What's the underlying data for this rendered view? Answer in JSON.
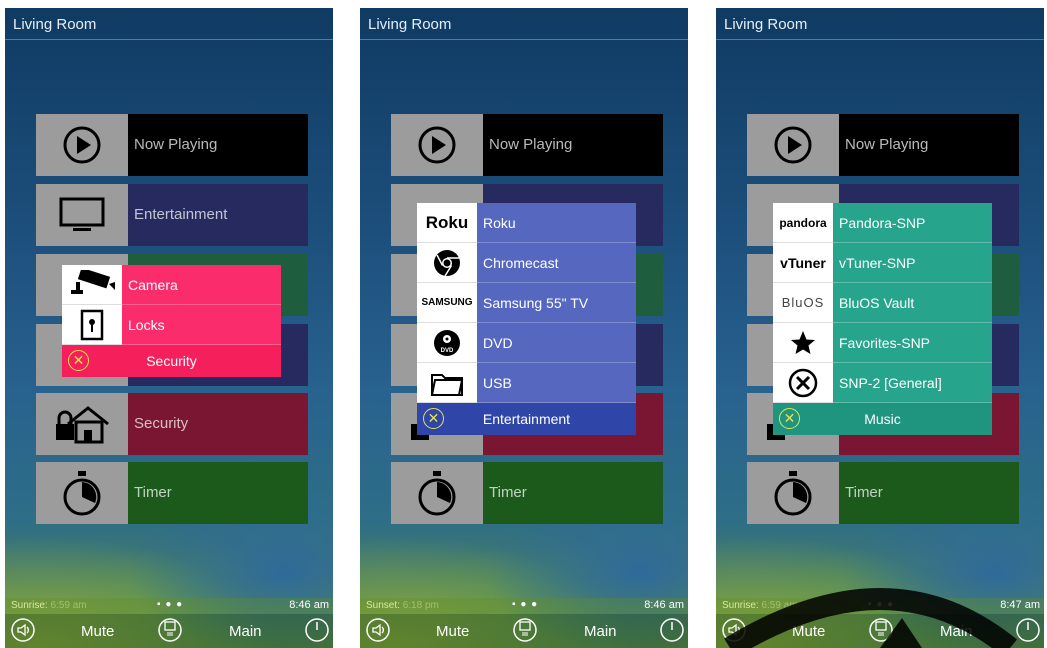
{
  "screens": [
    {
      "room": "Living Room",
      "tiles": [
        "Now Playing",
        "Entertainment",
        "",
        "",
        "Security",
        "Timer"
      ],
      "popup": {
        "items": [
          {
            "label": "Camera",
            "icon": "camera-icon"
          },
          {
            "label": "Locks",
            "icon": "lock-icon"
          }
        ],
        "footer": "Security"
      },
      "status": {
        "prefix": "Sunrise:",
        "value": "6:59 am",
        "time": "8:46 am"
      },
      "bottom": {
        "mute": "Mute",
        "main": "Main"
      }
    },
    {
      "room": "Living Room",
      "tiles": [
        "Now Playing",
        "",
        "",
        "",
        "",
        "Timer"
      ],
      "popup": {
        "items": [
          {
            "label": "Roku",
            "icon": "roku-logo"
          },
          {
            "label": "Chromecast",
            "icon": "chromecast-icon"
          },
          {
            "label": "Samsung 55\" TV",
            "icon": "samsung-logo"
          },
          {
            "label": "DVD",
            "icon": "dvd-icon"
          },
          {
            "label": "USB",
            "icon": "folder-icon"
          }
        ],
        "footer": "Entertainment"
      },
      "status": {
        "prefix": "Sunset:",
        "value": "6:18 pm",
        "time": "8:46 am"
      },
      "bottom": {
        "mute": "Mute",
        "main": "Main"
      }
    },
    {
      "room": "Living Room",
      "tiles": [
        "Now Playing",
        "",
        "",
        "",
        "",
        "Timer"
      ],
      "popup": {
        "items": [
          {
            "label": "Pandora-SNP",
            "icon": "pandora-logo"
          },
          {
            "label": "vTuner-SNP",
            "icon": "vtuner-logo"
          },
          {
            "label": "BluOS Vault",
            "icon": "bluos-logo"
          },
          {
            "label": "Favorites-SNP",
            "icon": "star-icon"
          },
          {
            "label": "SNP-2 [General]",
            "icon": "tools-icon"
          }
        ],
        "footer": "Music"
      },
      "status": {
        "prefix": "Sunrise:",
        "value": "6:59 am",
        "time": "8:47 am"
      },
      "bottom": {
        "mute": "Mute",
        "main": "Main"
      }
    }
  ],
  "logos": {
    "roku": "Roku",
    "samsung": "SAMSUNG",
    "pandora": "pandora",
    "vtuner": "vTuner",
    "bluos": "BluOS",
    "dvd": "DVD"
  },
  "colors": {
    "now_playing": "#000000",
    "entertainment": "#262a5e",
    "music": "#1e5e3e",
    "security": "#7a1631",
    "timer": "#1c5a1c",
    "security_popup": "#fb2c6c",
    "security_footer": "#f51f5c",
    "entertainment_popup": "#5567bf",
    "entertainment_footer": "#2f46a8",
    "music_popup": "#27a58c",
    "music_footer": "#1f9580"
  }
}
